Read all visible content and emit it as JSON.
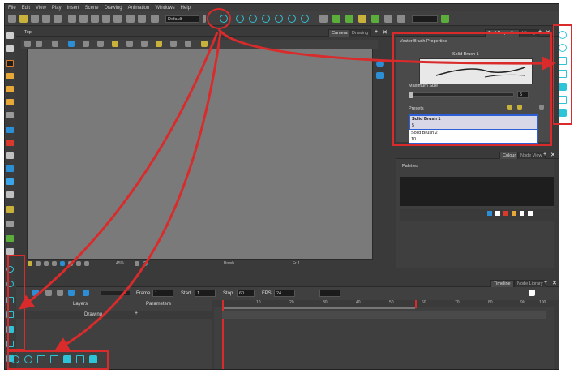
{
  "menu": [
    "File",
    "Edit",
    "View",
    "Play",
    "Insert",
    "Scene",
    "Drawing",
    "Animation",
    "Windows",
    "Help"
  ],
  "toolbar": {
    "workspace_select": "Default"
  },
  "view": {
    "top_label": "Top",
    "tabs": [
      "Camera",
      "Drawing"
    ],
    "zoom": "45%",
    "tool_name": "Brush",
    "frame_status": "Fr 1"
  },
  "tool_properties": {
    "tabs": [
      "Tool Properties",
      "Library"
    ],
    "title": "Vector Brush Properties",
    "preview_label": "Solid Brush 1",
    "max_size_label": "Maximum Size",
    "max_size_value": "5",
    "presets_label": "Presets",
    "presets": [
      {
        "name": "Solid Brush 1",
        "size": "5"
      },
      {
        "name": "Solid Brush 2",
        "size": "10"
      }
    ]
  },
  "colour": {
    "tabs": [
      "Colour",
      "Node View"
    ],
    "palettes_label": "Palettes",
    "swatch_colors": [
      "#ffffff",
      "#d93a2b",
      "#e8a838",
      "#ffffff",
      "#ffffff"
    ]
  },
  "timeline": {
    "tabs": [
      "Timeline",
      "Node Library"
    ],
    "frame_label": "Frame",
    "frame_value": "1",
    "start_label": "Start",
    "start_value": "1",
    "stop_label": "Stop",
    "stop_value": "60",
    "fps_label": "FPS",
    "fps_value": "24",
    "layers_header": "Layers",
    "params_header": "Parameters",
    "layer_name": "Drawing",
    "ruler": [
      "10",
      "20",
      "30",
      "40",
      "50",
      "60",
      "70",
      "80",
      "90",
      "100"
    ]
  },
  "colors": {
    "highlight": "#d92b2b",
    "accent_cyan": "#2ec4d8",
    "canvas": "#7a7a7a"
  }
}
